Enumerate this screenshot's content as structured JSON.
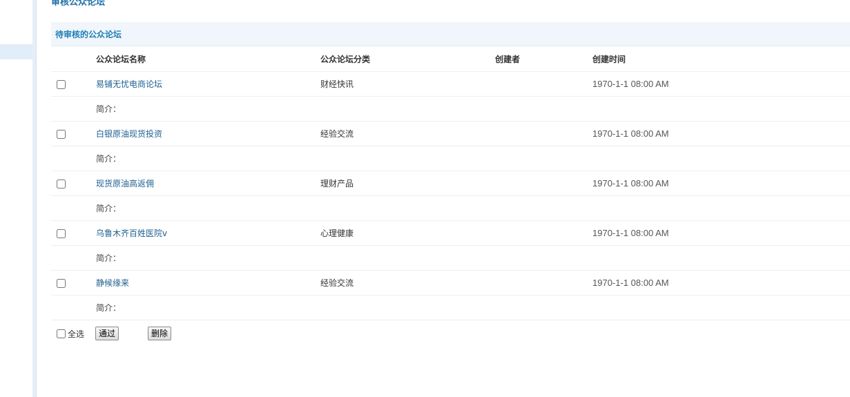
{
  "page_title": "审核公众论坛",
  "section_title": "待审核的公众论坛",
  "table": {
    "headers": {
      "name": "公众论坛名称",
      "category": "公众论坛分类",
      "creator": "创建者",
      "created": "创建时间"
    },
    "rows": [
      {
        "name": "易铺无忧电商论坛",
        "category": "财经快讯",
        "creator": "",
        "created": "1970-1-1 08:00 AM",
        "intro_label": "简介："
      },
      {
        "name": "白银原油现货投资",
        "category": "经验交流",
        "creator": "",
        "created": "1970-1-1 08:00 AM",
        "intro_label": "简介："
      },
      {
        "name": "现货原油高返佣",
        "category": "理财产品",
        "creator": "",
        "created": "1970-1-1 08:00 AM",
        "intro_label": "简介："
      },
      {
        "name": "乌鲁木齐百姓医院v",
        "category": "心理健康",
        "creator": "",
        "created": "1970-1-1 08:00 AM",
        "intro_label": "简介："
      },
      {
        "name": "静候缘来",
        "category": "经验交流",
        "creator": "",
        "created": "1970-1-1 08:00 AM",
        "intro_label": "简介："
      }
    ]
  },
  "footer": {
    "select_all_label": "全选",
    "approve_label": "通过",
    "delete_label": "删除"
  },
  "colors": {
    "title": "#1f6fa8",
    "section_title": "#1f7fb5",
    "link": "#1f5f8f",
    "section_bg": "#f0f6fb"
  }
}
